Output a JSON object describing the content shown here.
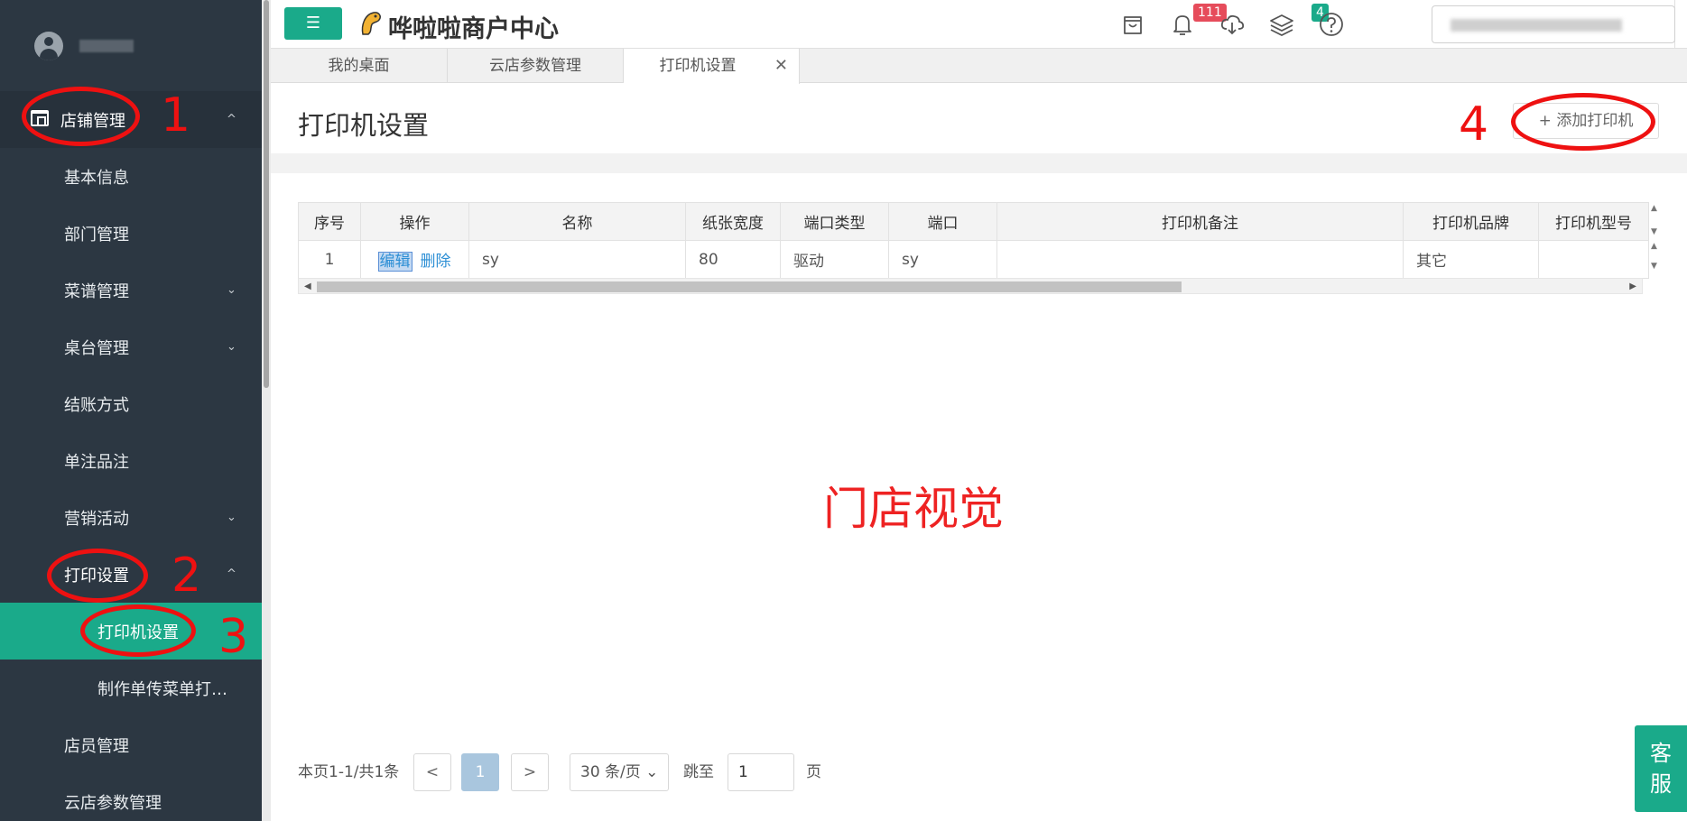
{
  "sidebar": {
    "items": [
      {
        "label": "店铺管理",
        "chev": "^"
      },
      {
        "label": "基本信息"
      },
      {
        "label": "部门管理"
      },
      {
        "label": "菜谱管理",
        "chev": "⌄"
      },
      {
        "label": "桌台管理",
        "chev": "⌄"
      },
      {
        "label": "结账方式"
      },
      {
        "label": "单注品注"
      },
      {
        "label": "营销活动",
        "chev": "⌄"
      },
      {
        "label": "打印设置",
        "chev": "^"
      },
      {
        "label": "打印机设置"
      },
      {
        "label": "制作单传菜单打…"
      },
      {
        "label": "店员管理"
      },
      {
        "label": "云店参数管理"
      }
    ]
  },
  "header": {
    "brand": "哗啦啦商户中心",
    "menu_icon": "☰",
    "notifications_count": "111",
    "layers_count": "4"
  },
  "tabs": [
    {
      "label": "我的桌面"
    },
    {
      "label": "云店参数管理"
    },
    {
      "label": "打印机设置",
      "close": "✕"
    }
  ],
  "page": {
    "title": "打印机设置",
    "add_button": "+  添加打印机",
    "watermark": "门店视觉"
  },
  "table": {
    "columns": [
      "序号",
      "操作",
      "名称",
      "纸张宽度",
      "端口类型",
      "端口",
      "打印机备注",
      "打印机品牌",
      "打印机型号"
    ],
    "rows": [
      {
        "index": "1",
        "edit": "编辑",
        "delete": "删除",
        "name": "sy",
        "paper_width": "80",
        "port_type": "驱动",
        "port": "sy",
        "remark": "",
        "brand": "其它",
        "model": ""
      }
    ]
  },
  "annotations": [
    "1",
    "2",
    "3",
    "4"
  ],
  "pagination": {
    "summary": "本页1-1/共1条",
    "prev": "<",
    "current": "1",
    "next": ">",
    "page_size": "30 条/页 ⌄",
    "jump_label": "跳至",
    "jump_value": "1",
    "page_suffix": "页"
  },
  "service": {
    "line1": "客",
    "line2": "服"
  },
  "colors": {
    "accent": "#1aaa8a",
    "sidebar": "#2c3742",
    "annotation": "#ee1111"
  }
}
